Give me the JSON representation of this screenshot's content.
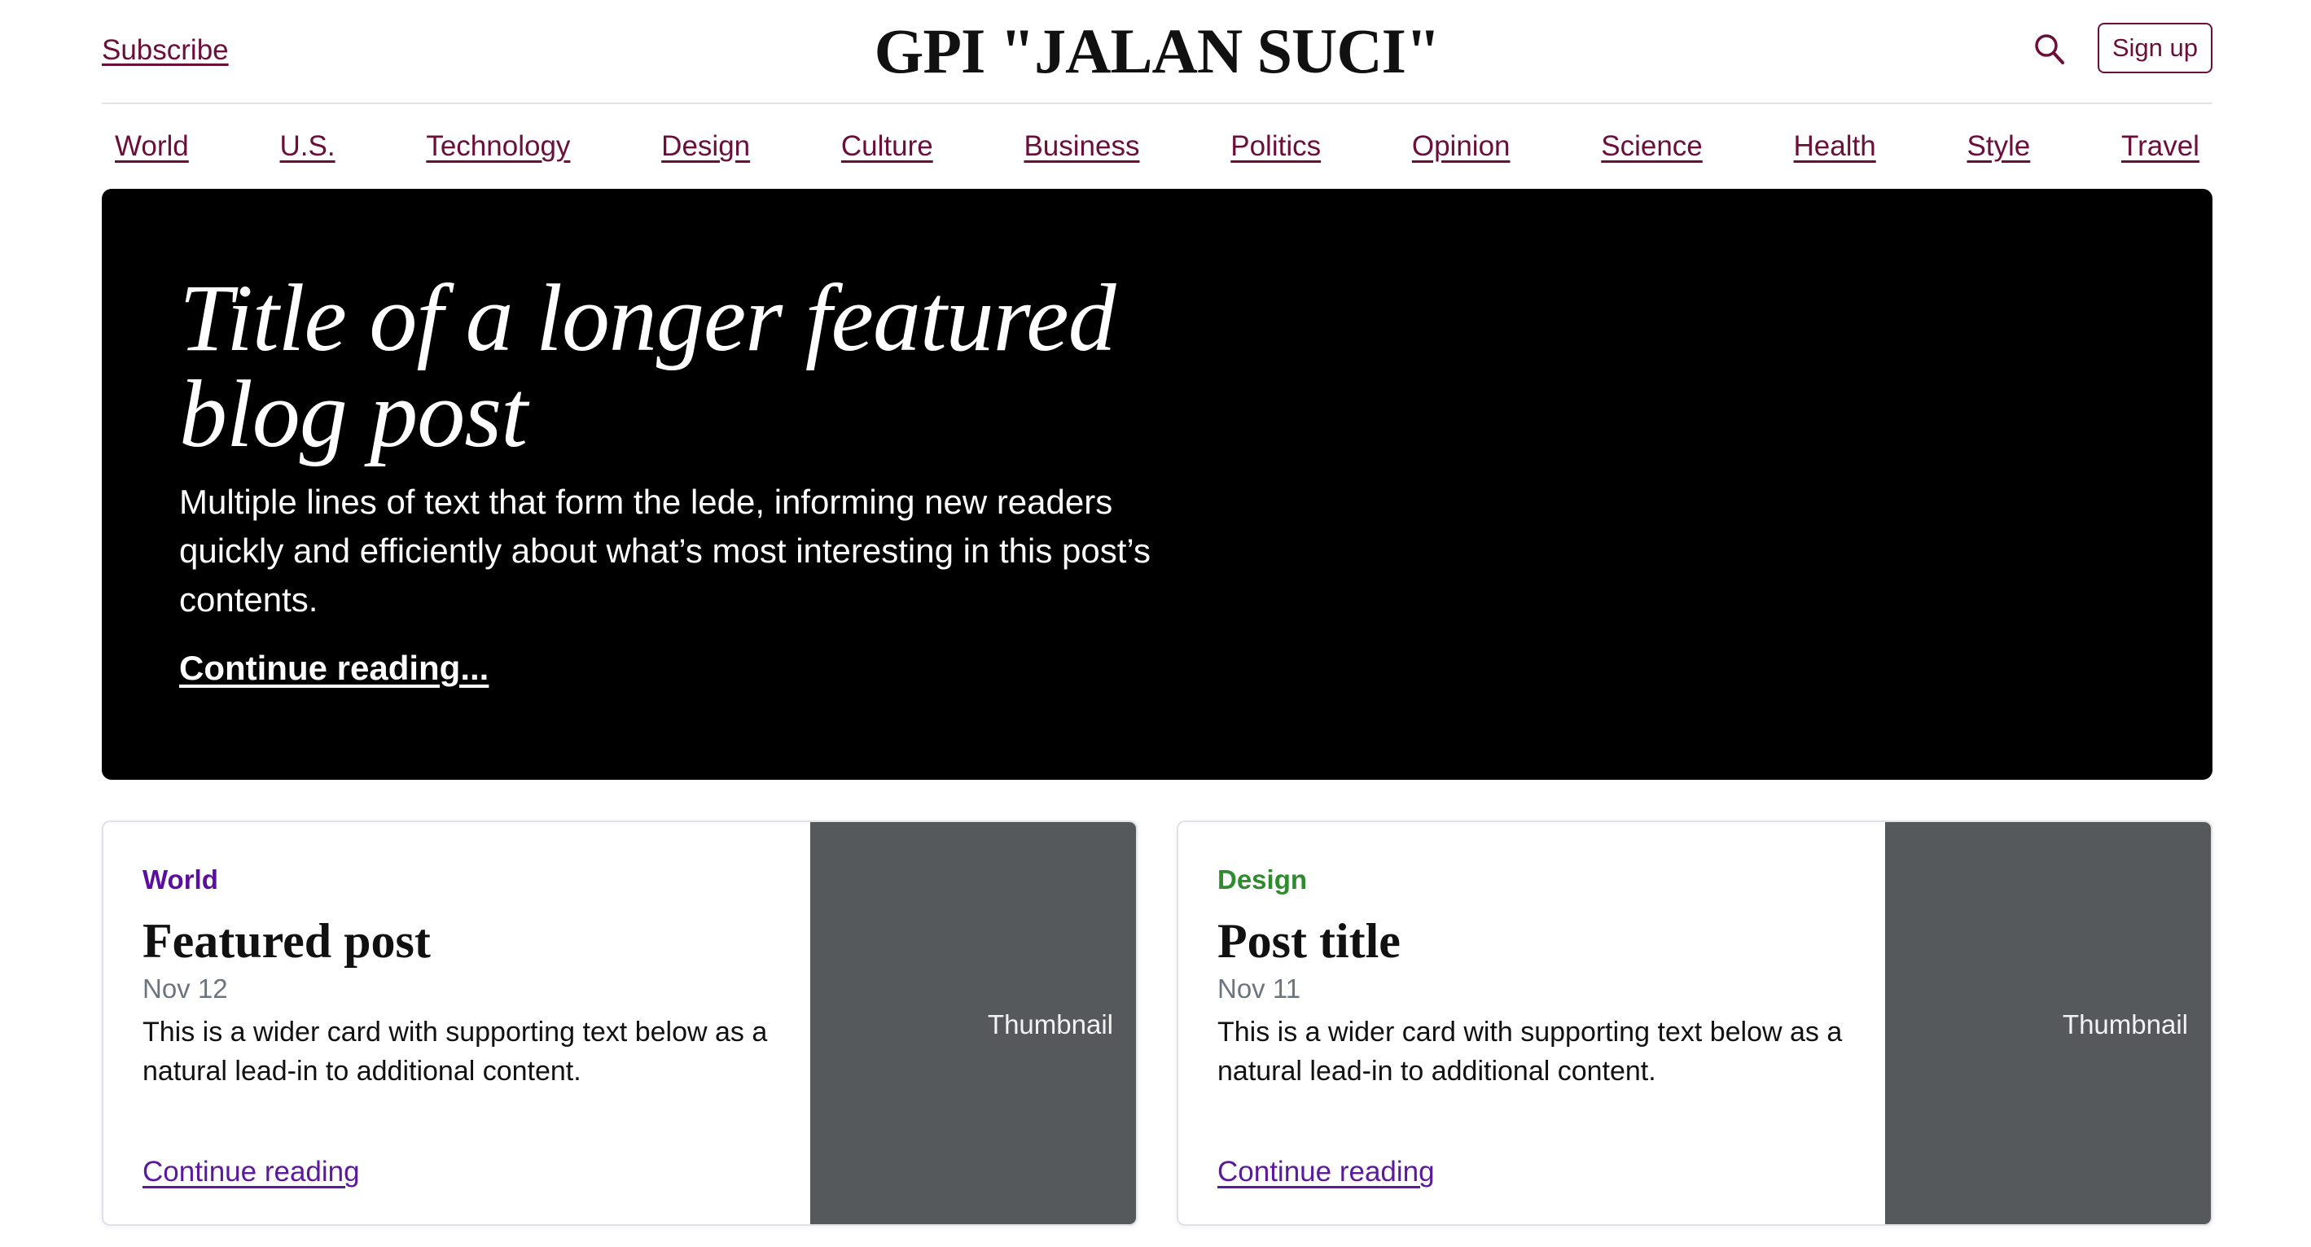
{
  "header": {
    "subscribe_label": "Subscribe",
    "brand": "GPI \"JALAN SUCI\"",
    "search_icon": "search-icon",
    "signup_label": "Sign up"
  },
  "nav": {
    "items": [
      "World",
      "U.S.",
      "Technology",
      "Design",
      "Culture",
      "Business",
      "Politics",
      "Opinion",
      "Science",
      "Health",
      "Style",
      "Travel"
    ]
  },
  "hero": {
    "title": "Title of a longer featured blog post",
    "lede": "Multiple lines of text that form the lede, informing new readers quickly and efficiently about what’s most interesting in this post’s contents.",
    "link": "Continue reading..."
  },
  "cards": [
    {
      "category": "World",
      "category_color": "#5b0f9e",
      "title": "Featured post",
      "date": "Nov 12",
      "text": "This is a wider card with supporting text below as a natural lead-in to additional content.",
      "link": "Continue reading",
      "thumbnail": "Thumbnail"
    },
    {
      "category": "Design",
      "category_color": "#2e8b2e",
      "title": "Post title",
      "date": "Nov 11",
      "text": "This is a wider card with supporting text below as a natural lead-in to additional content.",
      "link": "Continue reading",
      "thumbnail": "Thumbnail"
    }
  ],
  "colors": {
    "accent": "#6b0f3a",
    "hero_bg": "#000000",
    "thumbnail_bg": "#55595c"
  }
}
